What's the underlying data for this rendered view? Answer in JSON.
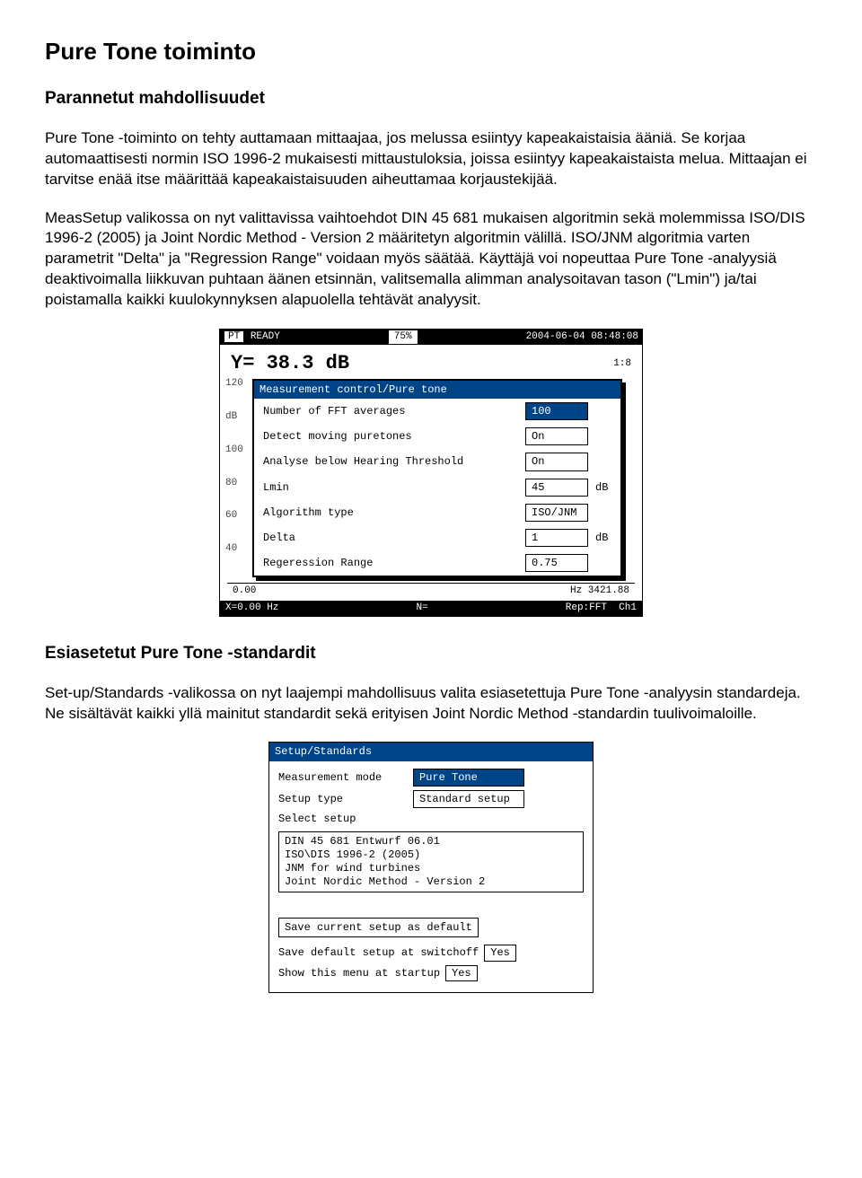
{
  "h1": "Pure Tone toiminto",
  "h2a": "Parannetut mahdollisuudet",
  "p1": "Pure Tone -toiminto on tehty auttamaan mittaajaa, jos melussa esiintyy kapeakaistaisia ääniä. Se korjaa automaattisesti normin ISO 1996-2 mukaisesti mittaustuloksia, joissa esiintyy kapeakaistaista melua. Mittaajan ei tarvitse enää itse määrittää kapeakaistaisuuden aiheuttamaa korjaustekijää.",
  "p2": "MeasSetup valikossa on nyt valittavissa vaihtoehdot DIN 45 681 mukaisen algoritmin sekä molemmissa ISO/DIS 1996-2 (2005) ja Joint Nordic Method - Version 2 määritetyn algoritmin välillä. ISO/JNM algoritmia varten parametrit \"Delta\" ja \"Regression Range\" voidaan myös säätää. Käyttäjä voi nopeuttaa Pure Tone -analyysiä deaktivoimalla liikkuvan puhtaan äänen etsinnän, valitsemalla alimman analysoitavan tason (\"Lmin\") ja/tai poistamalla kaikki kuulokynnyksen alapuolella tehtävät analyysit.",
  "ss1": {
    "topLeftBox": "PT",
    "topLeft": "READY",
    "topPct": "75%",
    "topDate": "2004-06-04 08:48:08",
    "y": "Y=   38.3 dB",
    "scale": "1:8",
    "axis": [
      "120",
      "dB",
      "100",
      "80",
      "60",
      "40"
    ],
    "dialogTitle": "Measurement control/Pure tone",
    "rows": [
      {
        "label": "Number of FFT averages",
        "val": "100",
        "unit": "",
        "hl": true
      },
      {
        "label": "Detect moving puretones",
        "val": "On",
        "unit": ""
      },
      {
        "label": "Analyse below Hearing Threshold",
        "val": "On",
        "unit": ""
      },
      {
        "label": "Lmin",
        "val": "45",
        "unit": "dB"
      },
      {
        "label": "Algorithm type",
        "val": "ISO/JNM",
        "unit": ""
      },
      {
        "label": "Delta",
        "val": "1",
        "unit": "dB"
      },
      {
        "label": "Regeression Range",
        "val": "0.75",
        "unit": ""
      }
    ],
    "bottomL": "0.00",
    "bottomR": "Hz 3421.88",
    "bbarL": "X=0.00 Hz",
    "bbarM": "N=",
    "bbarR1": "Rep:FFT",
    "bbarR2": "Ch1"
  },
  "h2b": "Esiasetetut Pure Tone -standardit",
  "p3": "Set-up/Standards -valikossa on nyt laajempi mahdollisuus valita esiasetettuja Pure Tone -analyysin standardeja. Ne sisältävät kaikki yllä mainitut standardit sekä erityisen Joint Nordic Method -standardin tuulivoimaloille.",
  "ss2": {
    "title": "Setup/Standards",
    "modeLabel": "Measurement mode",
    "modeVal": "Pure Tone",
    "setupTypeLabel": "Setup type",
    "setupTypeVal": "Standard setup",
    "selectLabel": "Select setup",
    "list": [
      "DIN 45 681 Entwurf 06.01",
      "ISO\\DIS 1996-2 (2005)",
      "JNM for wind turbines",
      "Joint Nordic Method - Version 2"
    ],
    "btn": "Save current setup as default",
    "row2Label": "Save default setup at switchoff",
    "row2Val": "Yes",
    "row3Label": "Show this menu at startup",
    "row3Val": "Yes"
  }
}
